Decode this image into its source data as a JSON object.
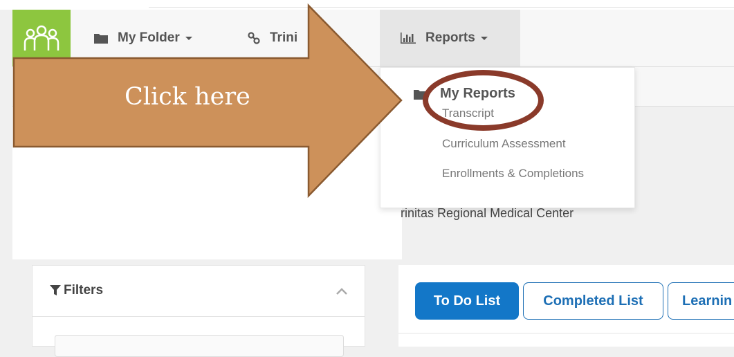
{
  "nav": {
    "my_folder": "My Folder",
    "trinitas": "Trini",
    "reports": "Reports"
  },
  "dropdown": {
    "header": "My Reports",
    "items": [
      "Transcript",
      "Curriculum Assessment",
      "Enrollments & Completions"
    ]
  },
  "org_name": "rinitas Regional Medical Center",
  "filters": {
    "title": "Filters"
  },
  "tabs": {
    "todo": "To Do List",
    "completed": "Completed List",
    "learning": "Learnin"
  },
  "annotation": {
    "label": "Click here",
    "arrow_color": "#cd915a",
    "circle_color": "#8a3a2a"
  },
  "colors": {
    "logo_green": "#8dc63f",
    "primary_blue": "#1377c8"
  },
  "icons": [
    "people-icon",
    "folder-icon",
    "link-icon",
    "bar-chart-icon",
    "filter-icon",
    "chevron-up-icon"
  ]
}
